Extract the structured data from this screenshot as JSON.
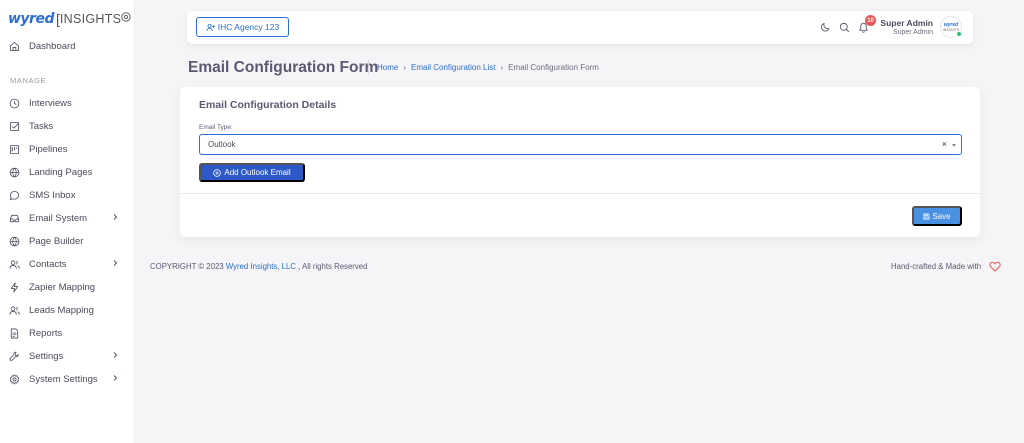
{
  "brand": {
    "name_part1": "wyred",
    "name_part2": "INSIGHTS",
    "bracket": "["
  },
  "sidebar": {
    "dashboard": "Dashboard",
    "section_label": "MANAGE",
    "items": [
      {
        "label": "Interviews",
        "icon": "clock-icon",
        "has_chevron": false
      },
      {
        "label": "Tasks",
        "icon": "checkbox-icon",
        "has_chevron": false
      },
      {
        "label": "Pipelines",
        "icon": "pipeline-icon",
        "has_chevron": false
      },
      {
        "label": "Landing Pages",
        "icon": "globe-icon",
        "has_chevron": false
      },
      {
        "label": "SMS Inbox",
        "icon": "chat-icon",
        "has_chevron": false
      },
      {
        "label": "Email System",
        "icon": "inbox-icon",
        "has_chevron": true
      },
      {
        "label": "Page Builder",
        "icon": "globe-icon",
        "has_chevron": false
      },
      {
        "label": "Contacts",
        "icon": "users-icon",
        "has_chevron": true
      },
      {
        "label": "Zapier Mapping",
        "icon": "lightning-icon",
        "has_chevron": false
      },
      {
        "label": "Leads Mapping",
        "icon": "users-icon",
        "has_chevron": false
      },
      {
        "label": "Reports",
        "icon": "document-icon",
        "has_chevron": false
      },
      {
        "label": "Settings",
        "icon": "wrench-icon",
        "has_chevron": true
      },
      {
        "label": "System Settings",
        "icon": "gear-icon",
        "has_chevron": true
      }
    ]
  },
  "topbar": {
    "agency_label": "IHC Agency 123",
    "notification_count": "10",
    "user_name": "Super Admin",
    "user_role": "Super Admin",
    "avatar_text1": "wyred",
    "avatar_text2": "INSIGHTS"
  },
  "page": {
    "title": "Email Configuration Form",
    "breadcrumb": [
      "Home",
      "Email Configuration List",
      "Email Configuration Form"
    ]
  },
  "card": {
    "title": "Email Configuration Details",
    "email_type_label": "Email Type:",
    "email_type_value": "Outlook",
    "clear_symbol": "×",
    "add_button": "Add Outlook Email",
    "save_button": "Save"
  },
  "footer": {
    "copyright": "COPYRIGHT © 2023",
    "company": "Wyred Insights, LLC",
    "rights": ", All rights Reserved",
    "made_with": "Hand-crafted & Made with"
  },
  "colors": {
    "primary": "#2c6fd0",
    "button": "#2c58c8",
    "save": "#4a90e2",
    "badge": "#ea5455",
    "online": "#28c76f"
  }
}
